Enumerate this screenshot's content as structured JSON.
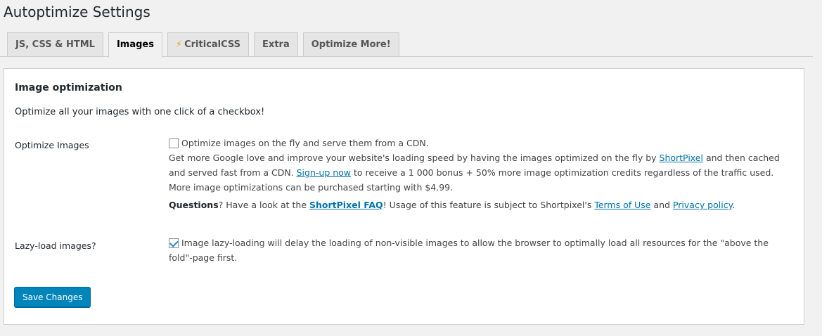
{
  "page_title": "Autoptimize Settings",
  "tabs": [
    {
      "label": "JS, CSS & HTML"
    },
    {
      "label": "Images",
      "active": true
    },
    {
      "label": "CriticalCSS",
      "icon": "lightning-icon"
    },
    {
      "label": "Extra"
    },
    {
      "label": "Optimize More!"
    }
  ],
  "section": {
    "title": "Image optimization",
    "intro": "Optimize all your images with one click of a checkbox!"
  },
  "optimize_images": {
    "label": "Optimize Images",
    "checked": false,
    "checkbox_text": "Optimize images on the fly and serve them from a CDN.",
    "desc_part1": "Get more Google love and improve your website's loading speed by having the images optimized on the fly by ",
    "shortpixel_link": "ShortPixel",
    "desc_part2": " and then cached and served fast from a CDN. ",
    "signup_link": "Sign-up now",
    "desc_part3": " to receive a 1 000 bonus + 50% more image optimization credits regardless of the traffic used. More image optimizations can be purchased starting with $4.99.",
    "questions_bold": "Questions",
    "questions_part1": "? Have a look at the ",
    "faq_link": "ShortPixel FAQ",
    "questions_part2": "! Usage of this feature is subject to Shortpixel's ",
    "terms_link": "Terms of Use",
    "questions_part3": " and ",
    "privacy_link": "Privacy policy",
    "questions_part4": "."
  },
  "lazy_load": {
    "label": "Lazy-load images?",
    "checked": true,
    "checkbox_text": "Image lazy-loading will delay the loading of non-visible images to allow the browser to optimally load all resources for the \"above the fold\"-page first."
  },
  "save_button": "Save Changes",
  "colors": {
    "link": "#0073aa",
    "button": "#0085ba",
    "bolt": "#f0a000"
  }
}
